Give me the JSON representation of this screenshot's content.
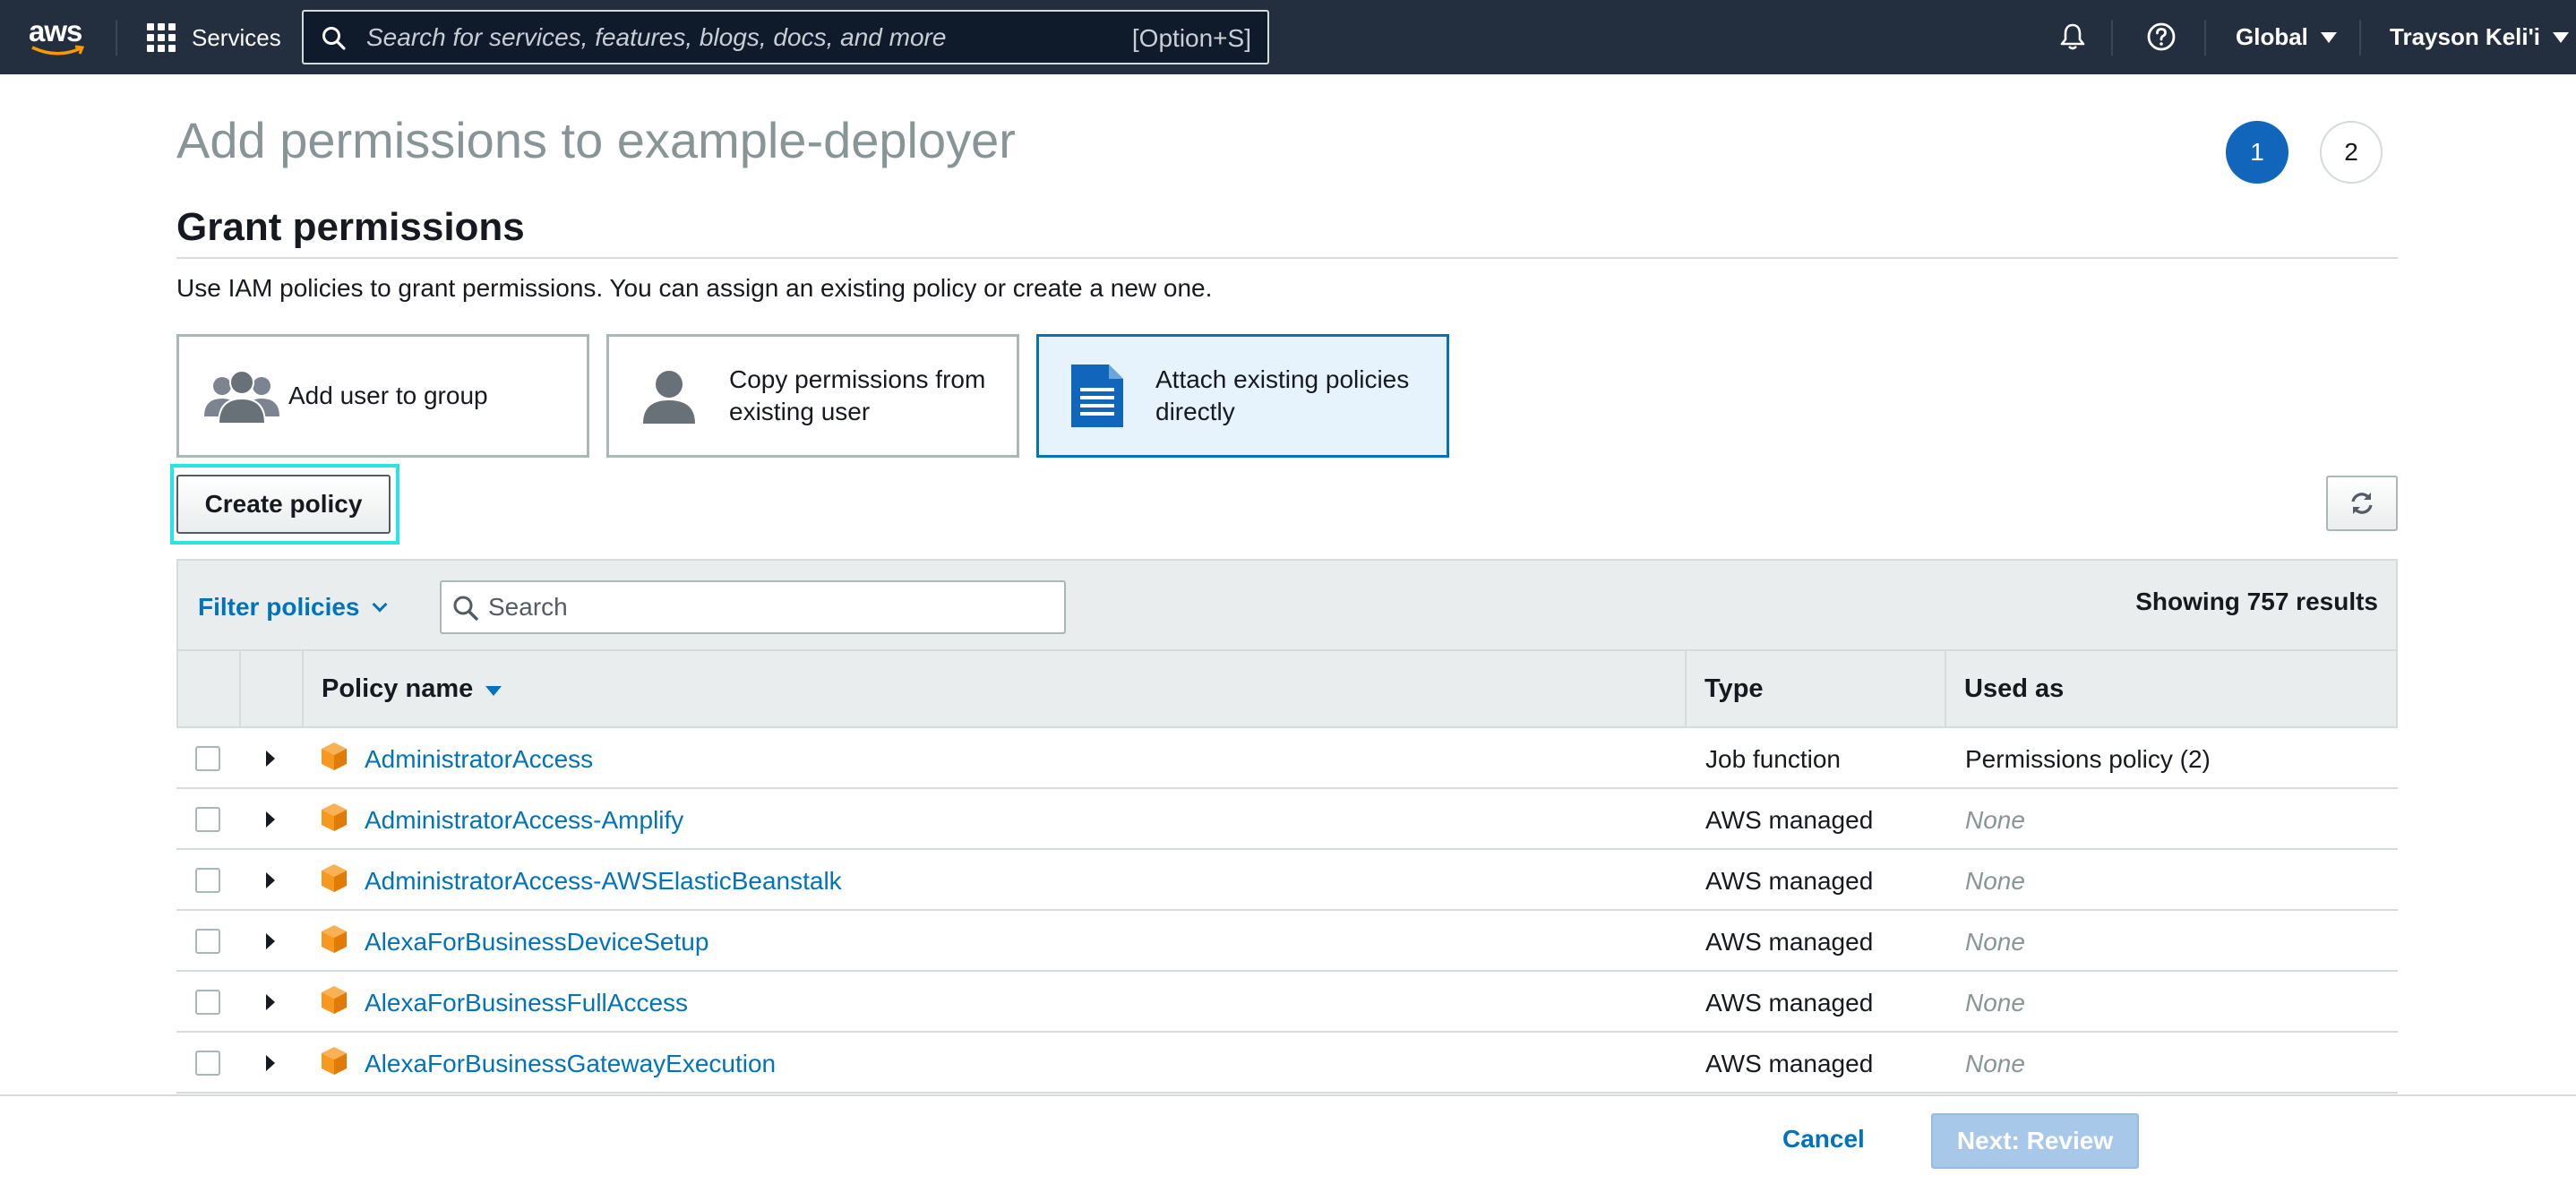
{
  "topnav": {
    "logo_text": "aws",
    "services_label": "Services",
    "search_placeholder": "Search for services, features, blogs, docs, and more",
    "search_shortcut": "[Option+S]",
    "region": "Global",
    "account": "Trayson Keli'i",
    "icons": [
      "grid-icon",
      "search-icon",
      "bell-icon",
      "help-icon",
      "caret-down-icon"
    ]
  },
  "header": {
    "title": "Add permissions to example-deployer",
    "steps": [
      "1",
      "2"
    ],
    "active_step": 1
  },
  "grant": {
    "section_title": "Grant permissions",
    "description": "Use IAM policies to grant permissions. You can assign an existing policy or create a new one.",
    "options": [
      {
        "label": "Add user to group",
        "icon": "group-icon",
        "selected": false
      },
      {
        "label_line1": "Copy permissions from",
        "label_line2": "existing user",
        "icon": "user-icon",
        "selected": false
      },
      {
        "label_line1": "Attach existing policies",
        "label_line2": "directly",
        "icon": "document-icon",
        "selected": true
      }
    ],
    "create_policy_label": "Create policy"
  },
  "table": {
    "filter_label": "Filter policies",
    "search_placeholder": "Search",
    "results_text": "Showing 757 results",
    "columns": {
      "name": "Policy name",
      "type": "Type",
      "used_as": "Used as"
    },
    "rows": [
      {
        "name": "AdministratorAccess",
        "type": "Job function",
        "used_as": "Permissions policy (2)"
      },
      {
        "name": "AdministratorAccess-Amplify",
        "type": "AWS managed",
        "used_as": "None"
      },
      {
        "name": "AdministratorAccess-AWSElasticBeanstalk",
        "type": "AWS managed",
        "used_as": "None"
      },
      {
        "name": "AlexaForBusinessDeviceSetup",
        "type": "AWS managed",
        "used_as": "None"
      },
      {
        "name": "AlexaForBusinessFullAccess",
        "type": "AWS managed",
        "used_as": "None"
      },
      {
        "name": "AlexaForBusinessGatewayExecution",
        "type": "AWS managed",
        "used_as": "None"
      }
    ]
  },
  "footer": {
    "cancel_label": "Cancel",
    "next_label": "Next: Review"
  },
  "colors": {
    "nav_bg": "#232f3e",
    "link": "#0073bb",
    "step_active": "#1166bb",
    "policy_icon": "#f7981f",
    "focus_ring": "#25e5e5",
    "next_disabled": "#a7c8e8"
  }
}
